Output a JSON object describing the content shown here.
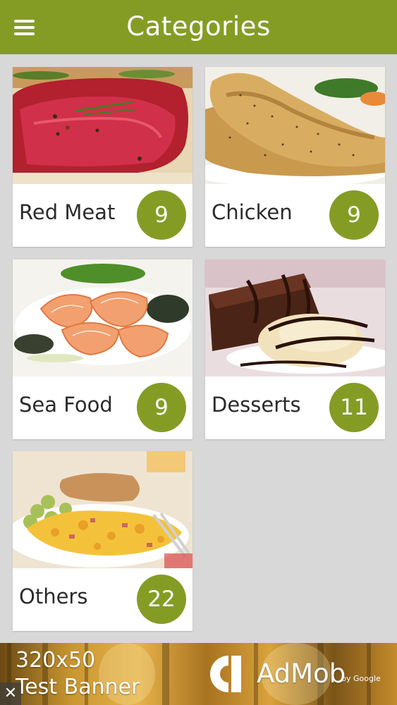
{
  "header": {
    "title": "Categories",
    "menu_icon": "hamburger-menu-icon",
    "color": "#859c24"
  },
  "categories": [
    {
      "label": "Red Meat",
      "count": "9",
      "image": "raw-steak-photo"
    },
    {
      "label": "Chicken",
      "count": "9",
      "image": "roast-chicken-leg-photo"
    },
    {
      "label": "Sea Food",
      "count": "9",
      "image": "shrimp-and-mussels-photo"
    },
    {
      "label": "Desserts",
      "count": "11",
      "image": "brownie-with-ice-cream-photo"
    },
    {
      "label": "Others",
      "count": "22",
      "image": "scrambled-eggs-breakfast-photo"
    }
  ],
  "ad": {
    "size_text": "320x50",
    "test_text": "Test Banner",
    "brand": "AdMob",
    "by": "by Google",
    "close_symbol": "✕"
  }
}
